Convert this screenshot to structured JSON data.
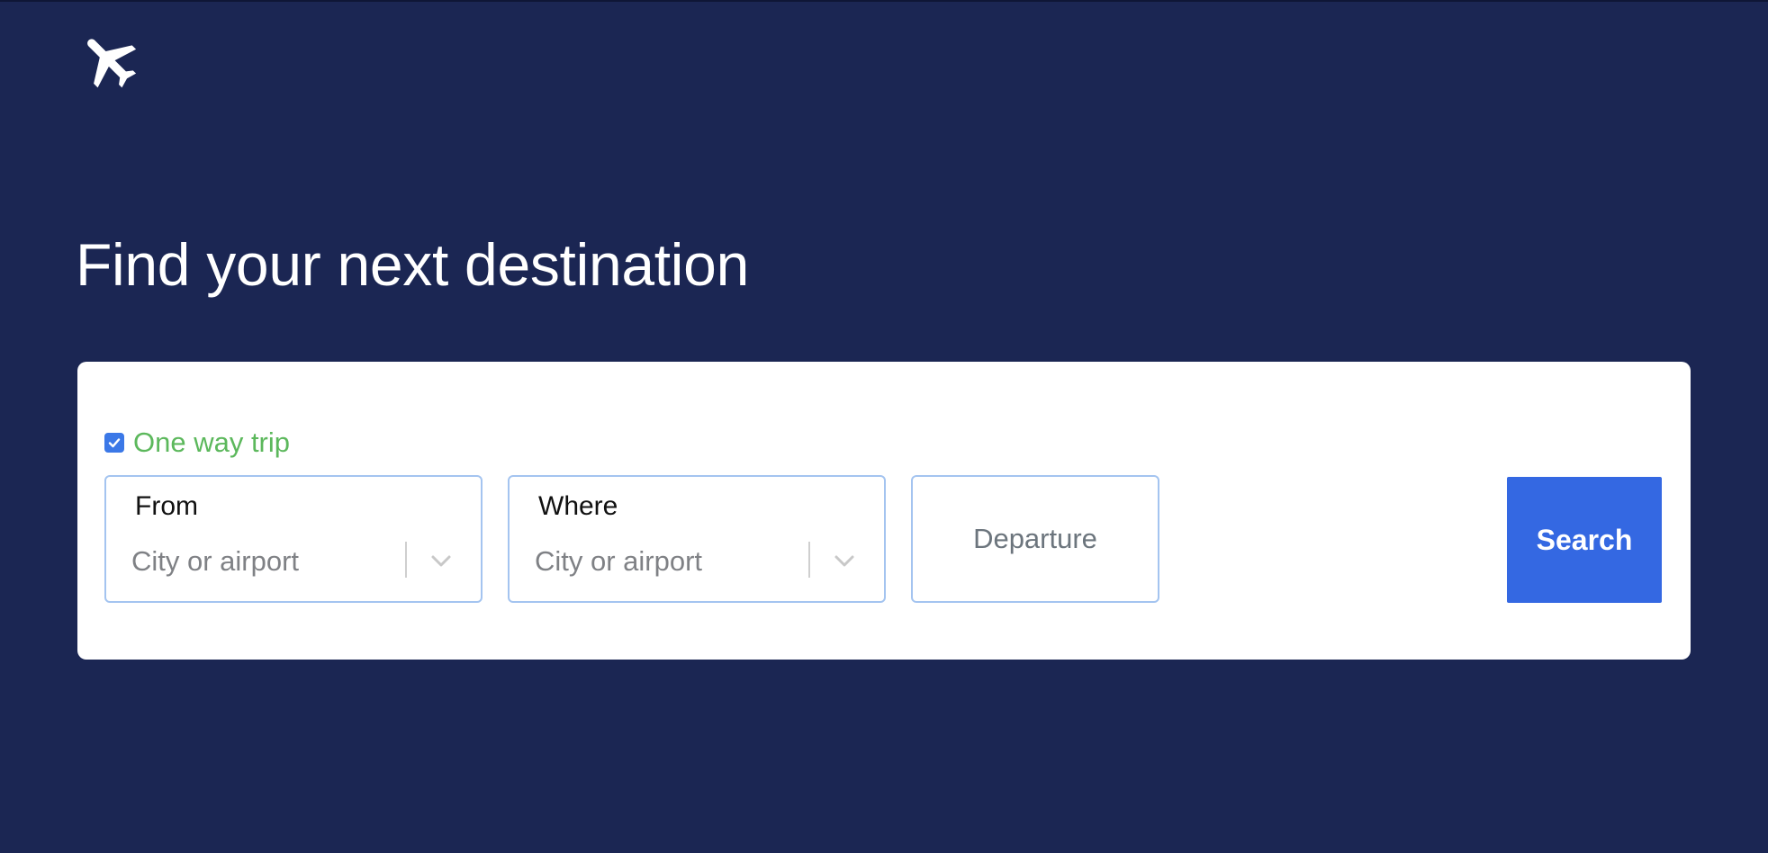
{
  "header": {
    "logo_icon": "airplane-icon"
  },
  "hero": {
    "title": "Find your next destination"
  },
  "search_form": {
    "one_way": {
      "label": "One way trip",
      "checked": true,
      "label_color": "#5cb85c"
    },
    "from": {
      "label": "From",
      "placeholder": "City or airport",
      "icon": "chevron-down-icon"
    },
    "where": {
      "label": "Where",
      "placeholder": "City or airport",
      "icon": "chevron-down-icon"
    },
    "departure": {
      "placeholder": "Departure"
    },
    "search_button": {
      "label": "Search",
      "color": "#3468e2"
    }
  },
  "colors": {
    "background": "#1b2653",
    "card": "#ffffff",
    "field_border": "#a4c4f0",
    "checkbox": "#3b78e7"
  }
}
